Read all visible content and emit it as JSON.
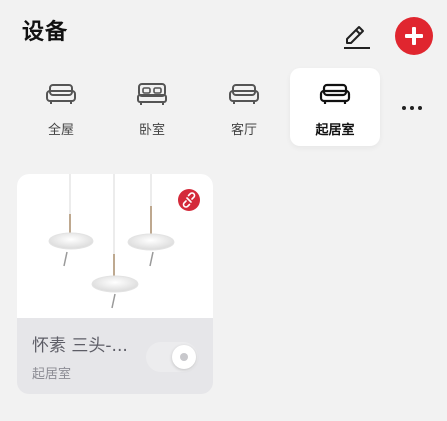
{
  "header": {
    "title": "设备",
    "edit_icon": "pencil-icon",
    "add_icon": "plus-icon",
    "accent_color": "#e0262f"
  },
  "rooms": {
    "items": [
      {
        "label": "全屋",
        "icon": "sofa-icon",
        "active": false
      },
      {
        "label": "卧室",
        "icon": "bed-icon",
        "active": false
      },
      {
        "label": "客厅",
        "icon": "sofa-icon",
        "active": false
      },
      {
        "label": "起居室",
        "icon": "sofa-icon",
        "active": true
      }
    ],
    "more_icon": "more-horizontal-icon"
  },
  "devices": [
    {
      "name": "怀素 三头-...",
      "room": "起居室",
      "image": "pendant-lamp-image",
      "badge_icon": "offline-link-icon",
      "badge_color": "#d42a3a",
      "power_on": false
    }
  ]
}
